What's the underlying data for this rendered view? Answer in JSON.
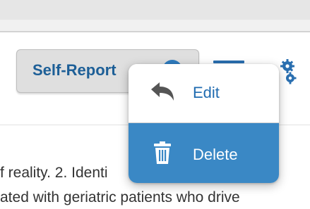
{
  "toolbar": {
    "self_report_label": "Self-Report"
  },
  "popup_menu": {
    "items": [
      {
        "label": "Edit",
        "icon": "undo-arrow-icon"
      },
      {
        "label": "Delete",
        "icon": "trash-icon"
      }
    ]
  },
  "body_text": {
    "line1": "f reality. 2. Identi",
    "line2": "ated with geriatric patients who drive"
  },
  "colors": {
    "accent_blue": "#2a6fb0",
    "delete_bg": "#3a88c5",
    "button_bg": "#dfdfdf"
  }
}
